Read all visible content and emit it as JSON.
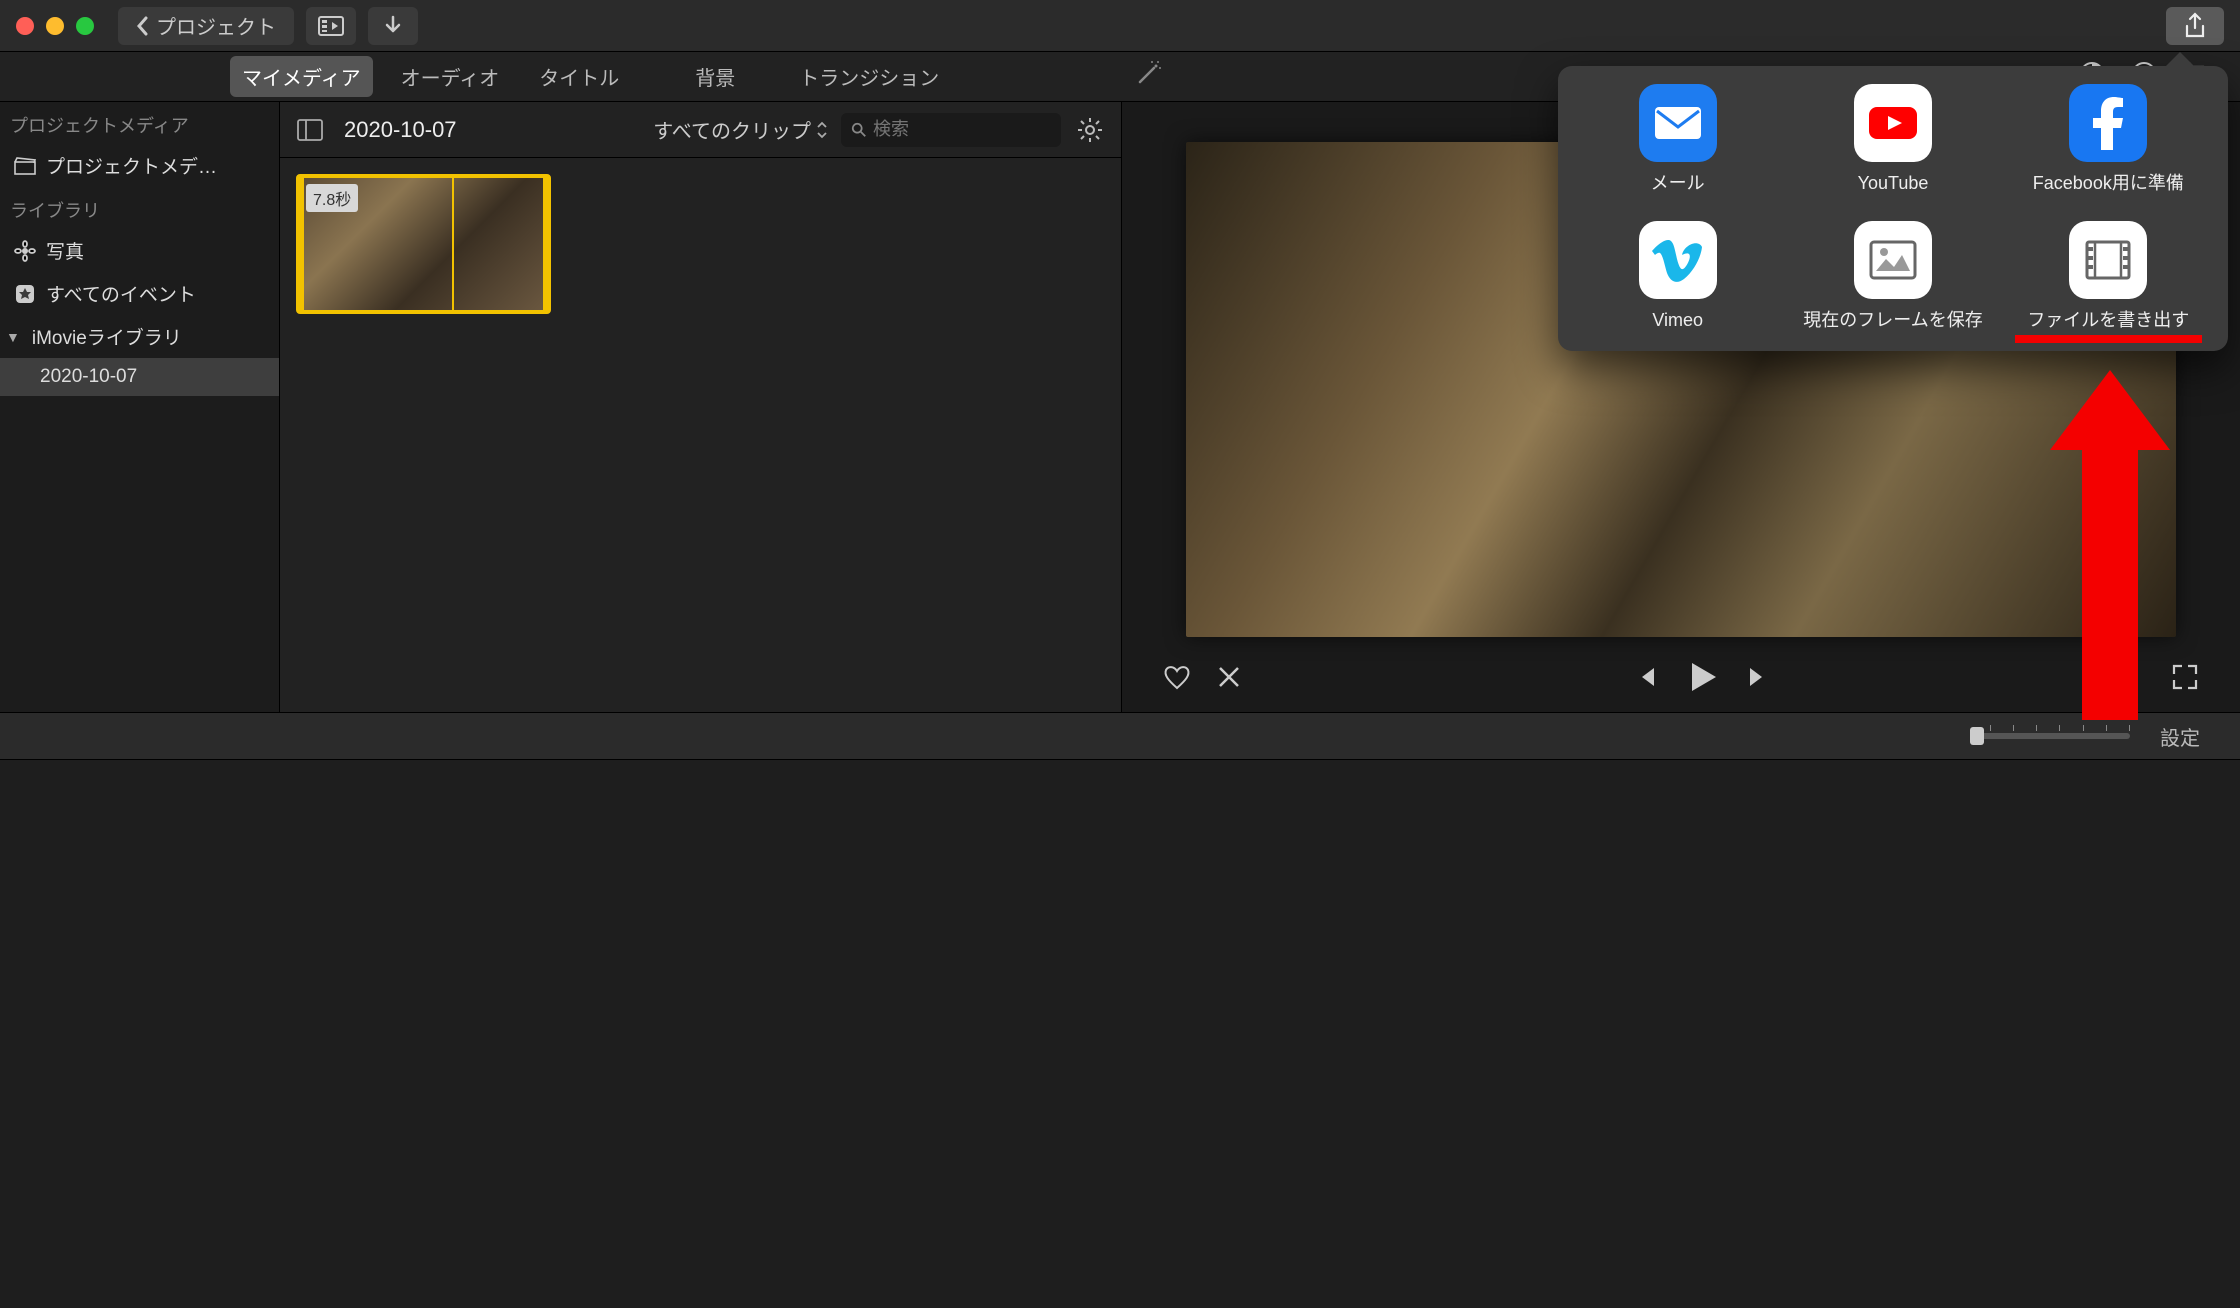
{
  "toolbar": {
    "back_label": "プロジェクト"
  },
  "tabs": {
    "my_media": "マイメディア",
    "audio": "オーディオ",
    "titles": "タイトル",
    "backgrounds": "背景",
    "transitions": "トランジション"
  },
  "sidebar": {
    "project_media_hdr": "プロジェクトメディア",
    "project_media_item": "プロジェクトメデ…",
    "library_hdr": "ライブラリ",
    "photos": "写真",
    "all_events": "すべてのイベント",
    "imovie_library": "iMovieライブラリ",
    "event1": "2020-10-07"
  },
  "browser": {
    "title": "2020-10-07",
    "filter": "すべてのクリップ",
    "search_placeholder": "検索",
    "clip_duration": "7.8秒"
  },
  "timeline": {
    "settings": "設定"
  },
  "share": {
    "mail": "メール",
    "youtube": "YouTube",
    "facebook": "Facebook用に準備",
    "vimeo": "Vimeo",
    "save_frame": "現在のフレームを保存",
    "export_file": "ファイルを書き出す"
  }
}
